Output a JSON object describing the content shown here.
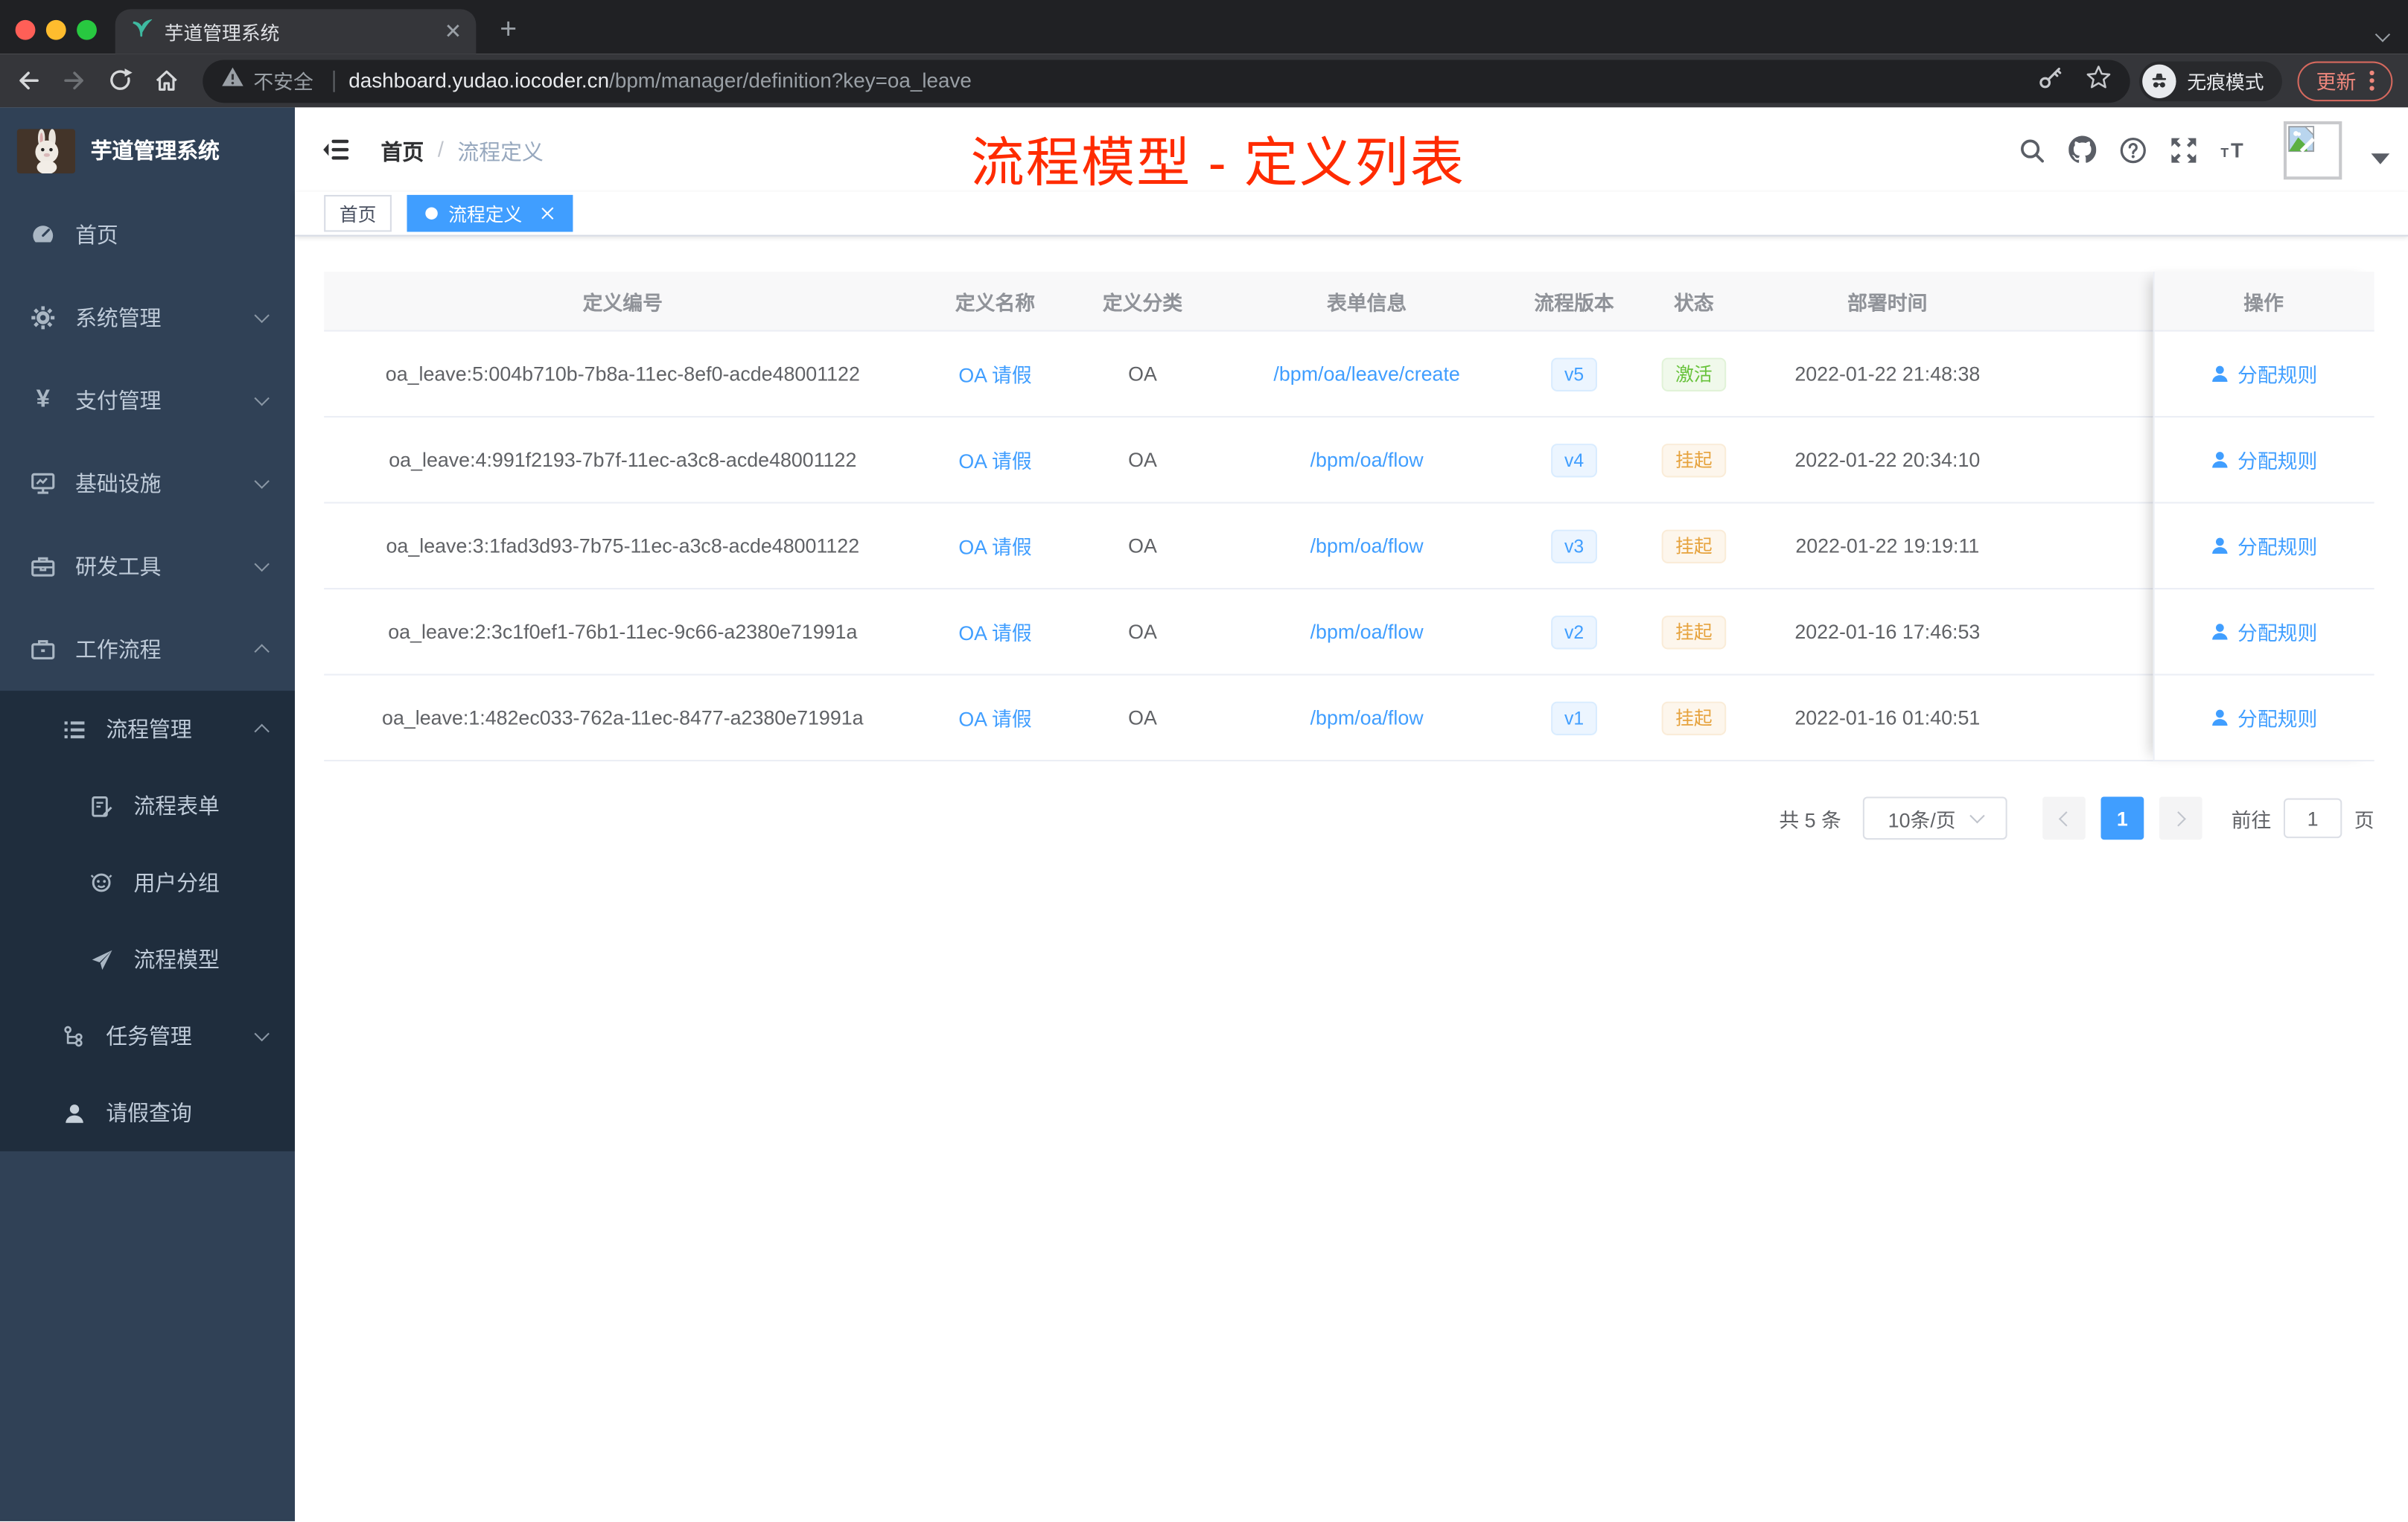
{
  "browser": {
    "tab_title": "芋道管理系统",
    "new_tab": "+",
    "address": {
      "security": "不安全",
      "host": "dashboard.yudao.iocoder.cn",
      "path": "/bpm/manager/definition?key=oa_leave"
    },
    "incognito_label": "无痕模式",
    "update_label": "更新"
  },
  "header": {
    "breadcrumb": {
      "home": "首页",
      "separator": "/",
      "current": "流程定义"
    }
  },
  "annotation": {
    "title": "流程模型 - 定义列表",
    "color": "#ff2b00"
  },
  "tags": {
    "home": "首页",
    "active": "流程定义"
  },
  "sidebar": {
    "logo_title": "芋道管理系统",
    "items": [
      {
        "label": "首页",
        "icon": "dashboard-icon"
      },
      {
        "label": "系统管理",
        "icon": "gear-icon"
      },
      {
        "label": "支付管理",
        "icon": "yen-icon"
      },
      {
        "label": "基础设施",
        "icon": "monitor-icon"
      },
      {
        "label": "研发工具",
        "icon": "toolbox-icon"
      },
      {
        "label": "工作流程",
        "icon": "briefcase-icon"
      }
    ],
    "sub_items": [
      {
        "label": "流程管理",
        "icon": "list-icon"
      },
      {
        "label": "流程表单",
        "icon": "form-icon"
      },
      {
        "label": "用户分组",
        "icon": "people-icon"
      },
      {
        "label": "流程模型",
        "icon": "send-icon"
      },
      {
        "label": "任务管理",
        "icon": "tree-icon"
      },
      {
        "label": "请假查询",
        "icon": "user-icon"
      }
    ],
    "yen_glyph": "¥"
  },
  "table": {
    "columns": [
      "定义编号",
      "定义名称",
      "定义分类",
      "表单信息",
      "流程版本",
      "状态",
      "部署时间",
      "操作"
    ],
    "rows": [
      {
        "id": "oa_leave:5:004b710b-7b8a-11ec-8ef0-acde48001122",
        "name": "OA 请假",
        "category": "OA",
        "form": "/bpm/oa/leave/create",
        "version": "v5",
        "status": "激活",
        "status_type": "success",
        "deploy_time": "2022-01-22 21:48:38",
        "action": "分配规则"
      },
      {
        "id": "oa_leave:4:991f2193-7b7f-11ec-a3c8-acde48001122",
        "name": "OA 请假",
        "category": "OA",
        "form": "/bpm/oa/flow",
        "version": "v4",
        "status": "挂起",
        "status_type": "warning",
        "deploy_time": "2022-01-22 20:34:10",
        "action": "分配规则"
      },
      {
        "id": "oa_leave:3:1fad3d93-7b75-11ec-a3c8-acde48001122",
        "name": "OA 请假",
        "category": "OA",
        "form": "/bpm/oa/flow",
        "version": "v3",
        "status": "挂起",
        "status_type": "warning",
        "deploy_time": "2022-01-22 19:19:11",
        "action": "分配规则"
      },
      {
        "id": "oa_leave:2:3c1f0ef1-76b1-11ec-9c66-a2380e71991a",
        "name": "OA 请假",
        "category": "OA",
        "form": "/bpm/oa/flow",
        "version": "v2",
        "status": "挂起",
        "status_type": "warning",
        "deploy_time": "2022-01-16 17:46:53",
        "action": "分配规则"
      },
      {
        "id": "oa_leave:1:482ec033-762a-11ec-8477-a2380e71991a",
        "name": "OA 请假",
        "category": "OA",
        "form": "/bpm/oa/flow",
        "version": "v1",
        "status": "挂起",
        "status_type": "warning",
        "deploy_time": "2022-01-16 01:40:51",
        "action": "分配规则"
      }
    ]
  },
  "pagination": {
    "total": "共 5 条",
    "page_size": "10条/页",
    "page": "1",
    "goto_label": "前往",
    "goto_value": "1",
    "unit": "页"
  },
  "colors": {
    "accent": "#409eff",
    "success": "#67c23a",
    "warning": "#e6a23c",
    "sidebar_bg": "#304156",
    "sidebar_sub_bg": "#1f2d3d",
    "annotation": "#ff2b00"
  }
}
